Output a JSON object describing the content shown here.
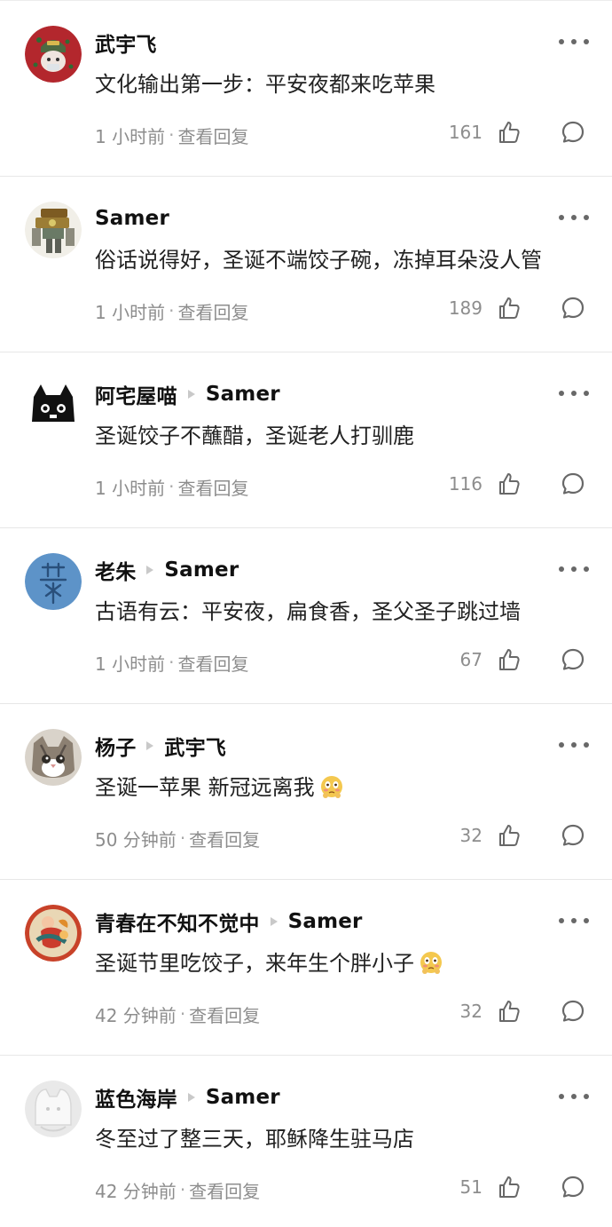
{
  "comments": [
    {
      "username": "武宇飞",
      "reply_to": "",
      "text": "文化输出第一步：平安夜都来吃苹果",
      "time": "1 小时前",
      "view_replies": "查看回复",
      "likes": "161",
      "avatar_icon": "cat-in-red-hat-avatar",
      "emoji": ""
    },
    {
      "username": "Samer",
      "reply_to": "",
      "text": "俗话说得好，圣诞不端饺子碗，冻掉耳朵没人管",
      "time": "1 小时前",
      "view_replies": "查看回复",
      "likes": "189",
      "avatar_icon": "mech-robot-avatar",
      "emoji": ""
    },
    {
      "username": "阿宅屋喵",
      "reply_to": "Samer",
      "text": "圣诞饺子不蘸醋，圣诞老人打驯鹿",
      "time": "1 小时前",
      "view_replies": "查看回复",
      "likes": "116",
      "avatar_icon": "black-cat-avatar",
      "emoji": ""
    },
    {
      "username": "老朱",
      "reply_to": "Samer",
      "text": "古语有云：平安夜，扁食香，圣父圣子跳过墙",
      "time": "1 小时前",
      "view_replies": "查看回复",
      "likes": "67",
      "avatar_icon": "blue-calligraphy-avatar",
      "emoji": ""
    },
    {
      "username": "杨子",
      "reply_to": "武宇飞",
      "text": "圣诞一苹果 新冠远离我",
      "time": "50 分钟前",
      "view_replies": "查看回复",
      "likes": "32",
      "avatar_icon": "tabby-cat-avatar",
      "emoji": "flushed-face-emoji"
    },
    {
      "username": "青春在不知不觉中",
      "reply_to": "Samer",
      "text": "圣诞节里吃饺子，来年生个胖小子",
      "time": "42 分钟前",
      "view_replies": "查看回复",
      "likes": "32",
      "avatar_icon": "chinese-nianhua-avatar",
      "emoji": "flushed-face-emoji"
    },
    {
      "username": "蓝色海岸",
      "reply_to": "Samer",
      "text": "冬至过了整三天，耶稣降生驻马店",
      "time": "42 分钟前",
      "view_replies": "查看回复",
      "likes": "51",
      "avatar_icon": "white-cat-avatar",
      "emoji": ""
    }
  ],
  "icons": {
    "more": "more-dots-icon",
    "like": "thumbs-up-icon",
    "reply": "comment-bubble-icon",
    "reply_arrow": "reply-arrow-icon"
  },
  "colors": {
    "text_primary": "#111111",
    "text_secondary": "#8d8d8d",
    "divider": "#e7e7e7",
    "icon": "#686868"
  }
}
